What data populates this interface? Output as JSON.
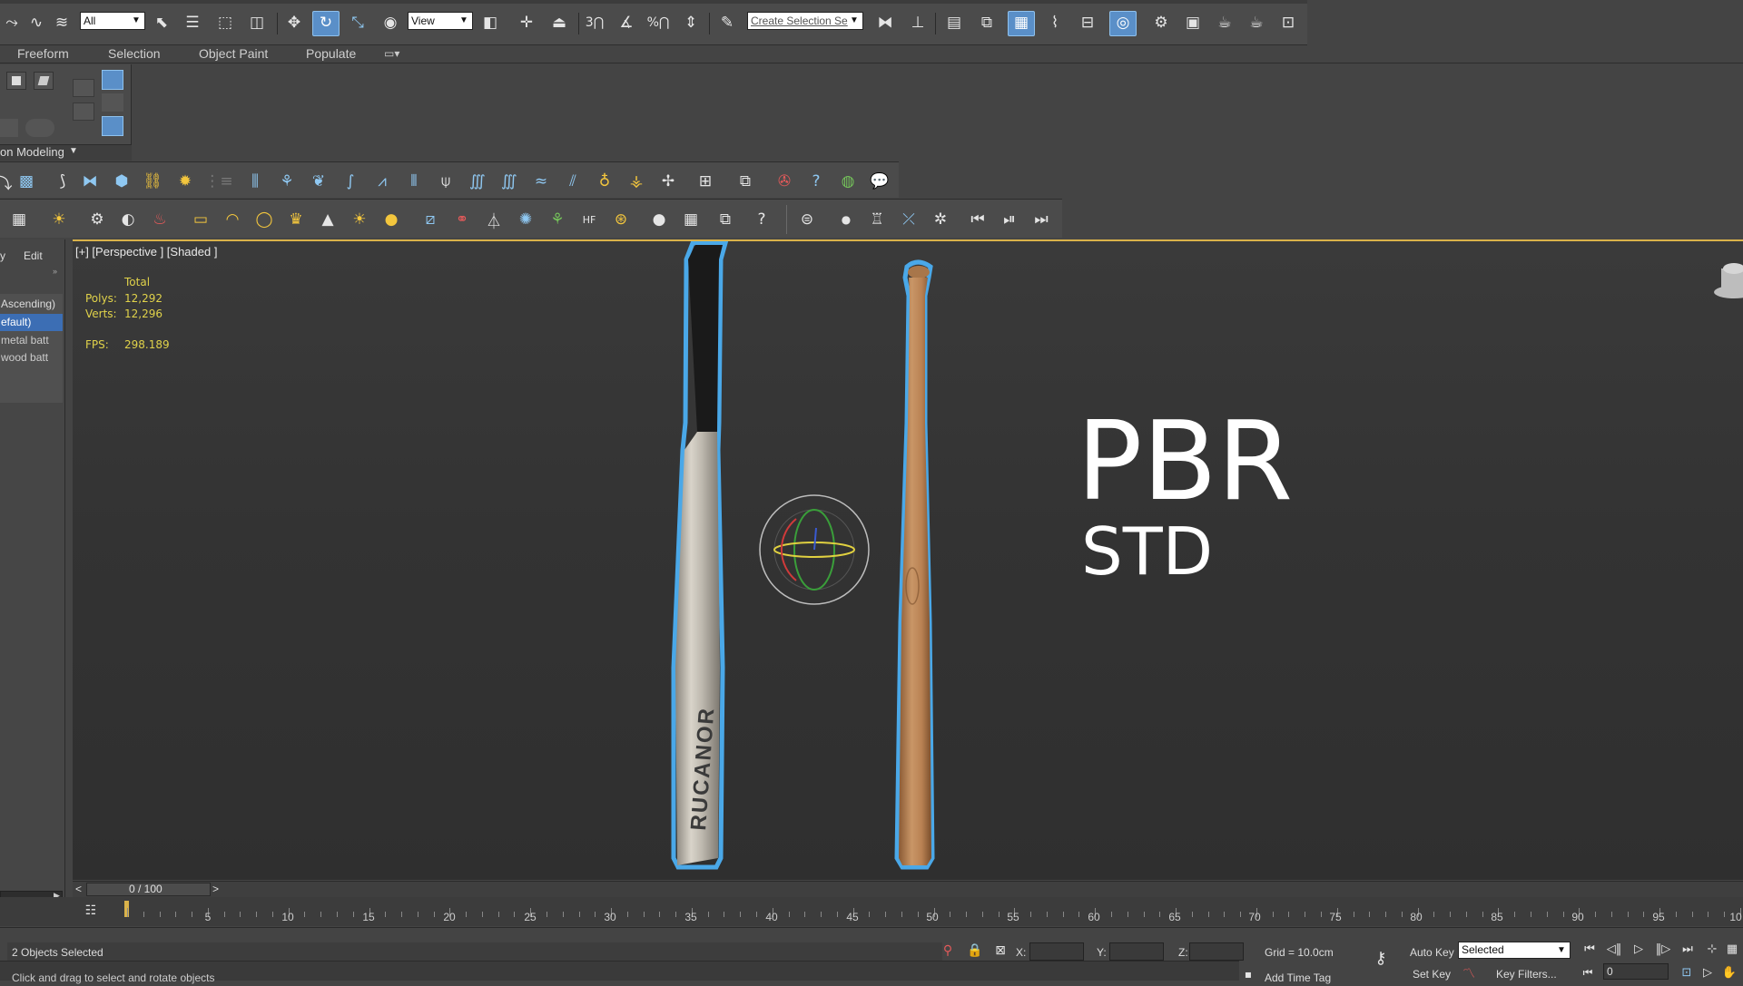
{
  "toolbar": {
    "filter_value": "All",
    "refcoord_value": "View",
    "named_selection_placeholder": "Create Selection Se",
    "snap_count": "3"
  },
  "ribbon": {
    "tabs": [
      "Freeform",
      "Selection",
      "Object Paint",
      "Populate"
    ],
    "section_label": "on Modeling"
  },
  "scene_explorer": {
    "menu": [
      "y",
      "Edit"
    ],
    "items": [
      "Ascending)",
      "efault)",
      "metal batt",
      "wood batt"
    ],
    "selected_index": 1
  },
  "viewport": {
    "label": "[+] [Perspective ] [Shaded ]",
    "stats": {
      "header": "Total",
      "polys_label": "Polys:",
      "polys_value": "12,292",
      "verts_label": "Verts:",
      "verts_value": "12,296",
      "fps_label": "FPS:",
      "fps_value": "298.189"
    },
    "overlay_title": "PBR",
    "overlay_subtitle": "STD",
    "bat_brand": "RUCANOR"
  },
  "timeline": {
    "frame_display": "0 / 100",
    "prev": "<",
    "next": ">",
    "ticks": [
      "5",
      "10",
      "15",
      "20",
      "25",
      "30",
      "35",
      "40",
      "45",
      "50",
      "55",
      "60",
      "65",
      "70",
      "75",
      "80",
      "85",
      "90",
      "95",
      "10"
    ]
  },
  "status": {
    "selection_text": "2 Objects Selected",
    "prompt_text": "Click and drag to select and rotate objects",
    "x_label": "X:",
    "y_label": "Y:",
    "z_label": "Z:",
    "grid_text": "Grid = 10.0cm",
    "add_time_tag": "Add Time Tag",
    "auto_key": "Auto Key",
    "set_key": "Set Key",
    "selected_value": "Selected",
    "key_filters": "Key Filters...",
    "frame_value": "0"
  },
  "colors": {
    "accent_gold": "#d9b24a",
    "selection_blue": "#4aa8e8",
    "stats_yellow": "#e0d24a"
  }
}
